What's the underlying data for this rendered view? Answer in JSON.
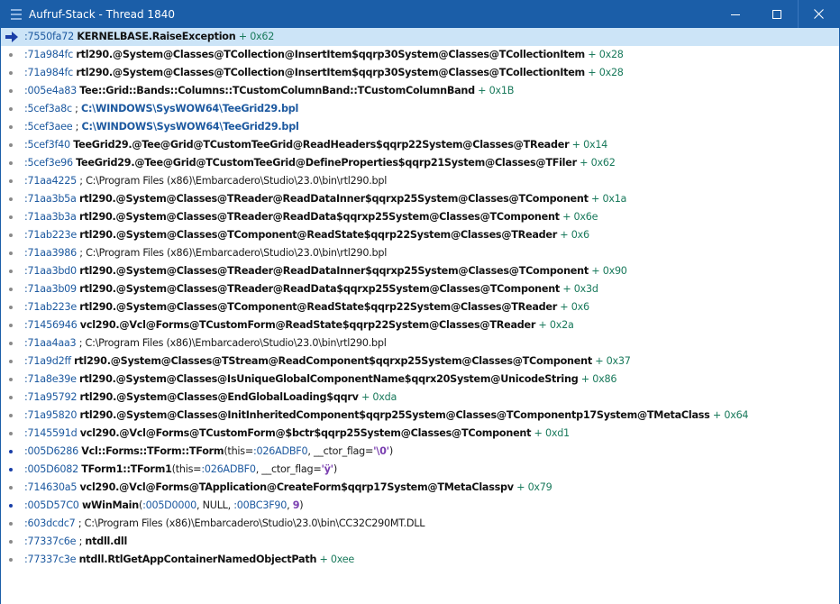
{
  "window": {
    "title": "Aufruf-Stack - Thread 1840",
    "menu_icon": "grip-icon",
    "controls": [
      "minimize-icon",
      "maximize-icon",
      "close-icon"
    ]
  },
  "colors": {
    "titlebar": "#1b5ea8",
    "current_row": "#cce4f7",
    "address": "#1e5aa0",
    "offset": "#1a7a5c",
    "path_x86": "#7a3fb0"
  },
  "rows": [
    {
      "address": ":7550fa72",
      "parts": [
        {
          "t": "sym",
          "v": "KERNELBASE.RaiseException"
        },
        {
          "t": "off",
          "v": " + 0x62"
        }
      ]
    },
    {
      "address": ":71a984fc",
      "parts": [
        {
          "t": "sym",
          "v": "rtl290.@System@Classes@TCollection@InsertItem$qqrp30System@Classes@TCollectionItem"
        },
        {
          "t": "off",
          "v": " + 0x28"
        }
      ]
    },
    {
      "address": ":71a984fc",
      "parts": [
        {
          "t": "sym",
          "v": "rtl290.@System@Classes@TCollection@InsertItem$qqrp30System@Classes@TCollectionItem"
        },
        {
          "t": "off",
          "v": " + 0x28"
        }
      ]
    },
    {
      "address": ":005e4a83",
      "parts": [
        {
          "t": "sym",
          "v": "Tee::Grid::Bands::Columns::TCustomColumnBand::TCustomColumnBand"
        },
        {
          "t": "off",
          "v": " + 0x1B"
        }
      ]
    },
    {
      "address": ":5cef3a8c",
      "parts": [
        {
          "t": "plain",
          "v": " ; "
        },
        {
          "t": "sysfile",
          "v": "C:\\WINDOWS\\SysWOW64\\TeeGrid29.bpl"
        }
      ]
    },
    {
      "address": ":5cef3aee",
      "parts": [
        {
          "t": "plain",
          "v": " ; "
        },
        {
          "t": "sysfile",
          "v": "C:\\WINDOWS\\SysWOW64\\TeeGrid29.bpl"
        }
      ]
    },
    {
      "address": ":5cef3f40",
      "parts": [
        {
          "t": "sym",
          "v": "TeeGrid29.@Tee@Grid@TCustomTeeGrid@ReadHeaders$qqrp22System@Classes@TReader"
        },
        {
          "t": "off",
          "v": "  + 0x14"
        }
      ]
    },
    {
      "address": ":5cef3e96",
      "parts": [
        {
          "t": "sym",
          "v": "TeeGrid29.@Tee@Grid@TCustomTeeGrid@DefineProperties$qqrp21System@Classes@TFiler"
        },
        {
          "t": "off",
          "v": "  + 0x62"
        }
      ]
    },
    {
      "address": ":71aa4225",
      "parts": [
        {
          "t": "plain",
          "v": " ; C:\\Program Files "
        },
        {
          "t": "x86",
          "v": "(x86)"
        },
        {
          "t": "rest",
          "v": "\\Embarcadero\\Studio\\23.0\\bin\\rtl290.bpl"
        }
      ]
    },
    {
      "address": ":71aa3b5a",
      "parts": [
        {
          "t": "sym",
          "v": "rtl290.@System@Classes@TReader@ReadDataInner$qqrxp25System@Classes@TComponent"
        },
        {
          "t": "off",
          "v": " + 0x1a"
        }
      ]
    },
    {
      "address": ":71aa3b3a",
      "parts": [
        {
          "t": "sym",
          "v": "rtl290.@System@Classes@TReader@ReadData$qqrxp25System@Classes@TComponent"
        },
        {
          "t": "off",
          "v": " + 0x6e"
        }
      ]
    },
    {
      "address": ":71ab223e",
      "parts": [
        {
          "t": "sym",
          "v": "rtl290.@System@Classes@TComponent@ReadState$qqrp22System@Classes@TReader"
        },
        {
          "t": "off",
          "v": " + 0x6"
        }
      ]
    },
    {
      "address": ":71aa3986",
      "parts": [
        {
          "t": "plain",
          "v": " ; C:\\Program Files "
        },
        {
          "t": "x86",
          "v": "(x86)"
        },
        {
          "t": "rest",
          "v": "\\Embarcadero\\Studio\\23.0\\bin\\rtl290.bpl"
        }
      ]
    },
    {
      "address": ":71aa3bd0",
      "parts": [
        {
          "t": "sym",
          "v": "rtl290.@System@Classes@TReader@ReadDataInner$qqrxp25System@Classes@TComponent"
        },
        {
          "t": "off",
          "v": " + 0x90"
        }
      ]
    },
    {
      "address": ":71aa3b09",
      "parts": [
        {
          "t": "sym",
          "v": "rtl290.@System@Classes@TReader@ReadData$qqrxp25System@Classes@TComponent"
        },
        {
          "t": "off",
          "v": " + 0x3d"
        }
      ]
    },
    {
      "address": ":71ab223e",
      "parts": [
        {
          "t": "sym",
          "v": "rtl290.@System@Classes@TComponent@ReadState$qqrp22System@Classes@TReader"
        },
        {
          "t": "off",
          "v": " + 0x6"
        }
      ]
    },
    {
      "address": ":71456946",
      "parts": [
        {
          "t": "sym",
          "v": "vcl290.@Vcl@Forms@TCustomForm@ReadState$qqrp22System@Classes@TReader"
        },
        {
          "t": "off",
          "v": " + 0x2a"
        }
      ]
    },
    {
      "address": ":71aa4aa3",
      "parts": [
        {
          "t": "plain",
          "v": " ; C:\\Program Files "
        },
        {
          "t": "x86",
          "v": "(x86)"
        },
        {
          "t": "rest",
          "v": "\\Embarcadero\\Studio\\23.0\\bin\\rtl290.bpl"
        }
      ]
    },
    {
      "address": ":71a9d2ff",
      "parts": [
        {
          "t": "sym",
          "v": "rtl290.@System@Classes@TStream@ReadComponent$qqrxp25System@Classes@TComponent"
        },
        {
          "t": "off",
          "v": " + 0x37"
        }
      ]
    },
    {
      "address": ":71a8e39e",
      "parts": [
        {
          "t": "sym",
          "v": "rtl290.@System@Classes@IsUniqueGlobalComponentName$qqrx20System@UnicodeString"
        },
        {
          "t": "off",
          "v": " + 0x86"
        }
      ]
    },
    {
      "address": ":71a95792",
      "parts": [
        {
          "t": "sym",
          "v": "rtl290.@System@Classes@EndGlobalLoading$qqrv"
        },
        {
          "t": "off",
          "v": " + 0xda"
        }
      ]
    },
    {
      "address": ":71a95820",
      "parts": [
        {
          "t": "sym",
          "v": "rtl290.@System@Classes@InitInheritedComponent$qqrp25System@Classes@TComponentp17System@TMetaClass"
        },
        {
          "t": "off",
          "v": " + 0x64"
        }
      ]
    },
    {
      "address": ":7145591d",
      "parts": [
        {
          "t": "sym",
          "v": "vcl290.@Vcl@Forms@TCustomForm@$bctr$qqrp25System@Classes@TComponent"
        },
        {
          "t": "off",
          "v": " + 0xd1"
        }
      ]
    },
    {
      "address": ":005D6286",
      "active": true,
      "parts": [
        {
          "t": "sym",
          "v": "Vcl::Forms::TForm::TForm"
        },
        {
          "t": "plain",
          "v": "(this="
        },
        {
          "t": "hexp",
          "v": ":026ADBF0"
        },
        {
          "t": "plain",
          "v": ", __ctor_flag="
        },
        {
          "t": "strp",
          "v": "'\\0'"
        },
        {
          "t": "plain",
          "v": ")"
        }
      ]
    },
    {
      "address": ":005D6082",
      "active": true,
      "parts": [
        {
          "t": "sym",
          "v": "TForm1::TForm1"
        },
        {
          "t": "plain",
          "v": "(this="
        },
        {
          "t": "hexp",
          "v": ":026ADBF0"
        },
        {
          "t": "plain",
          "v": ", __ctor_flag="
        },
        {
          "t": "strp",
          "v": "'ÿ'"
        },
        {
          "t": "plain",
          "v": ")"
        }
      ]
    },
    {
      "address": ":714630a5",
      "parts": [
        {
          "t": "sym",
          "v": "vcl290.@Vcl@Forms@TApplication@CreateForm$qqrp17System@TMetaClasspv"
        },
        {
          "t": "off",
          "v": " + 0x79"
        }
      ]
    },
    {
      "address": ":005D57C0",
      "active": true,
      "parts": [
        {
          "t": "sym",
          "v": "wWinMain"
        },
        {
          "t": "plain",
          "v": "("
        },
        {
          "t": "hexp",
          "v": ":005D0000"
        },
        {
          "t": "plain",
          "v": ", NULL, "
        },
        {
          "t": "hexp",
          "v": ":00BC3F90"
        },
        {
          "t": "plain",
          "v": ", "
        },
        {
          "t": "nump",
          "v": "9"
        },
        {
          "t": "plain",
          "v": ")"
        }
      ]
    },
    {
      "address": ":603dcdc7",
      "parts": [
        {
          "t": "plain",
          "v": " ; C:\\Program Files "
        },
        {
          "t": "x86",
          "v": "(x86)"
        },
        {
          "t": "rest",
          "v": "\\Embarcadero\\Studio\\23.0\\bin\\CC32C290MT.DLL"
        }
      ]
    },
    {
      "address": ":77337c6e",
      "parts": [
        {
          "t": "plain",
          "v": " ; "
        },
        {
          "t": "sym",
          "v": "ntdll.dll"
        }
      ]
    },
    {
      "address": ":77337c3e",
      "parts": [
        {
          "t": "sym",
          "v": "ntdll.RtlGetAppContainerNamedObjectPath"
        },
        {
          "t": "off",
          "v": " + 0xee"
        }
      ]
    }
  ]
}
